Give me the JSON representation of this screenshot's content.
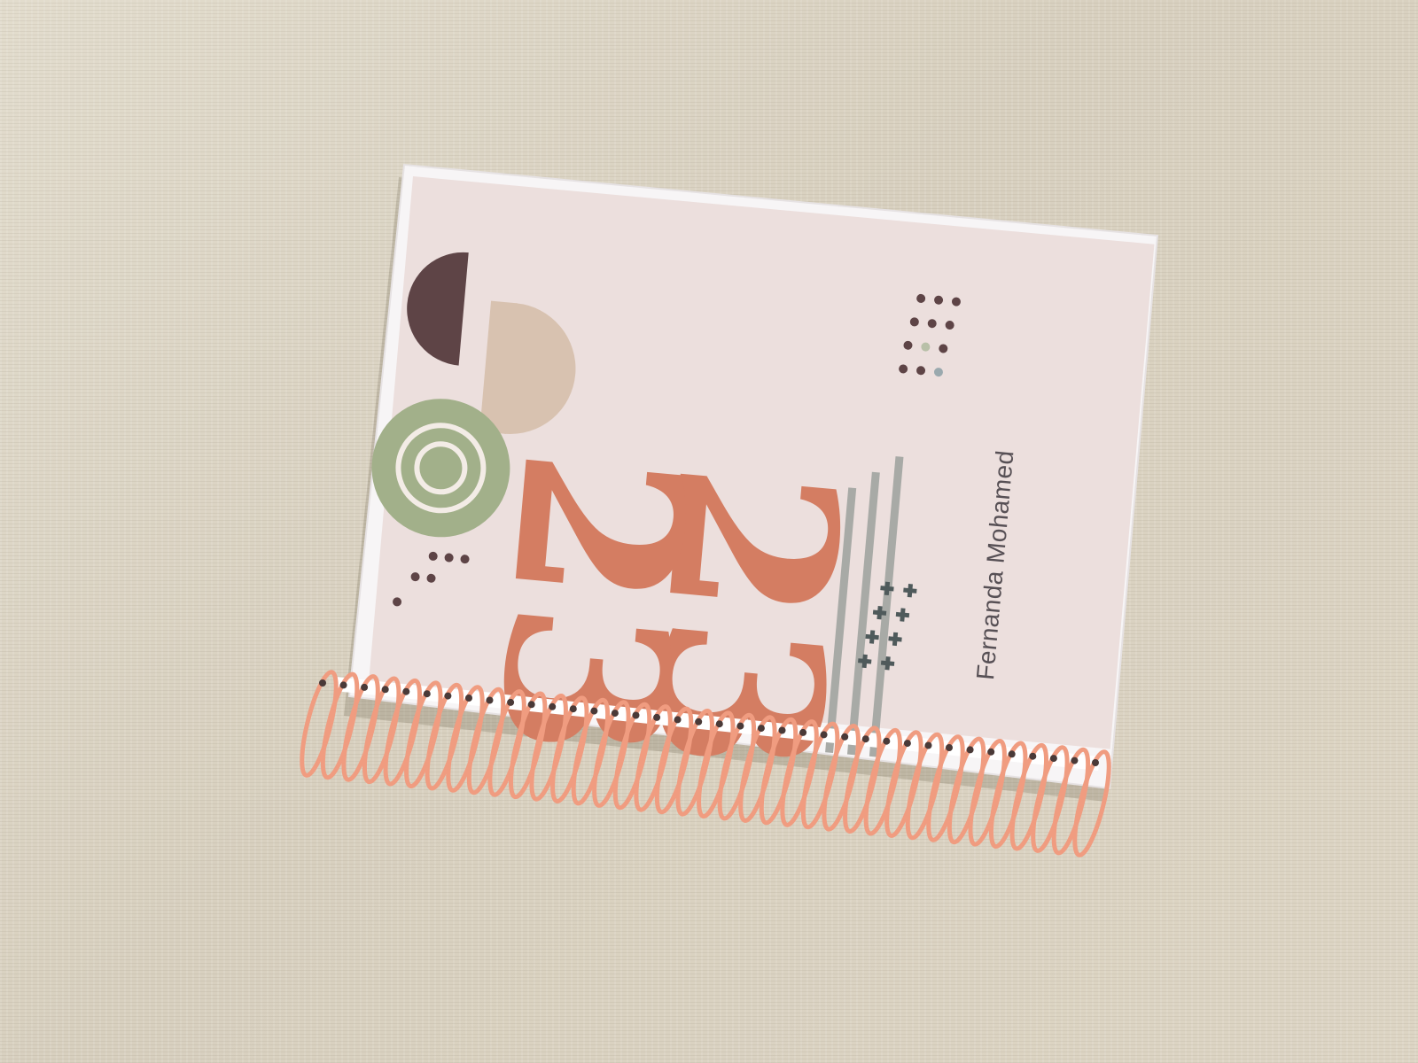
{
  "scene": {
    "description_kind": "photo of a spiral-bound planner cover on a fabric surface"
  },
  "cover": {
    "year_top": "23",
    "year_bottom": "23",
    "owner_name": "Fernanda Mohamed"
  },
  "colors": {
    "fabric": "#ddd6c6",
    "cover_bg": "#ecdfdd",
    "numeral": "#d47d62",
    "dark_circle": "#5e4446",
    "tan_arch": "#d8c2b0",
    "green_circle": "#a2b08a",
    "coil": "#f09c80",
    "stripes": "#a8aaa6",
    "plus_signs": "#4f5a5b"
  }
}
